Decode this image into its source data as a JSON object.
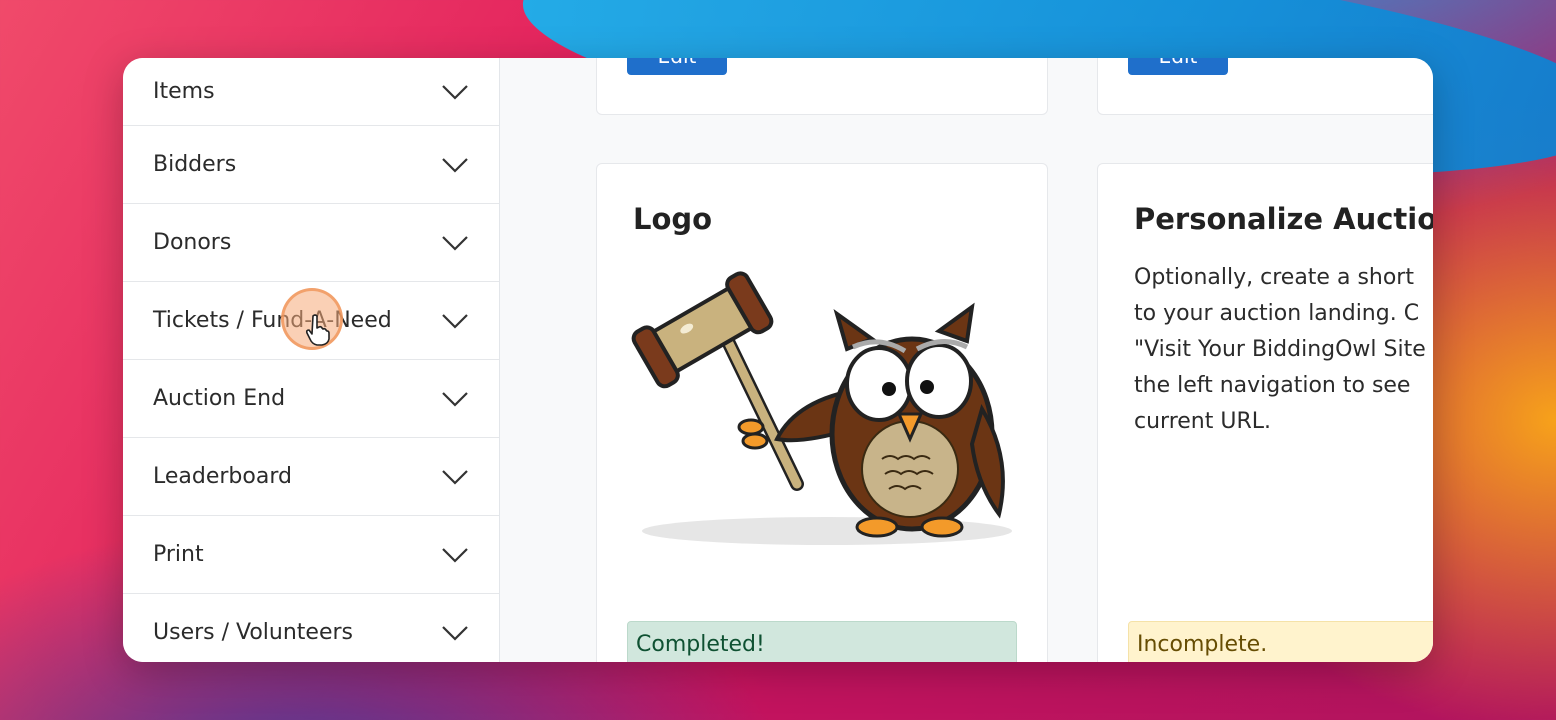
{
  "sidebar": {
    "items": [
      {
        "label": "Items"
      },
      {
        "label": "Bidders"
      },
      {
        "label": "Donors"
      },
      {
        "label": "Tickets / Fund-A-Need"
      },
      {
        "label": "Auction End"
      },
      {
        "label": "Leaderboard"
      },
      {
        "label": "Print"
      },
      {
        "label": "Users / Volunteers"
      }
    ]
  },
  "top_cards": {
    "left_button": "Edit",
    "right_button": "Edit"
  },
  "logo_card": {
    "title": "Logo",
    "status": "Completed!"
  },
  "personalize_card": {
    "title": "Personalize Auction",
    "lines": [
      "Optionally, create a short",
      "to your auction landing. C",
      "\"Visit Your BiddingOwl Site",
      "the left navigation to see",
      "current URL."
    ],
    "status": "Incomplete."
  },
  "colors": {
    "primary_button": "#1f6fcb",
    "completed_bg": "#d1e7dd",
    "completed_text": "#0f5132",
    "incomplete_bg": "#fff3cd",
    "incomplete_text": "#664d03"
  }
}
